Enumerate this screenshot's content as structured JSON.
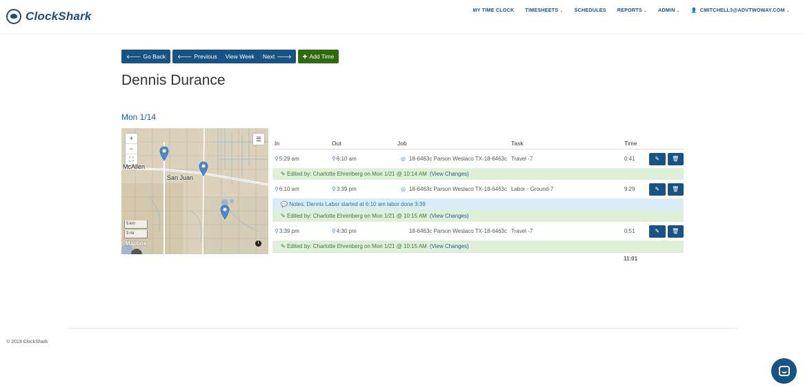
{
  "brand": {
    "name": "ClockShark"
  },
  "nav": {
    "my_time_clock": "MY TIME CLOCK",
    "timesheets": "TIMESHEETS",
    "schedules": "SCHEDULES",
    "reports": "REPORTS",
    "admin": "ADMIN",
    "user": "CMITCHELL3@ADVTWOWAY.COM"
  },
  "toolbar": {
    "go_back": "Go Back",
    "previous": "Previous",
    "view_week": "View Week",
    "next": "Next",
    "add_time": "Add Time"
  },
  "employee": {
    "name": "Dennis Durance"
  },
  "day": {
    "label": "Mon 1/14"
  },
  "map": {
    "zoom_in": "+",
    "zoom_out": "−",
    "labels": {
      "mcallen": "McAllen",
      "san_juan": "San Juan"
    },
    "scale_km": "5 km",
    "scale_mi": "3 mi",
    "attribution": "Mapbox",
    "info": "i"
  },
  "table": {
    "headers": {
      "in": "In",
      "out": "Out",
      "job": "Job",
      "task": "Task",
      "time": "Time"
    },
    "rows": [
      {
        "in": "5:29 am",
        "out": "6:10 am",
        "job": "18-6463c Parson Weslaco TX-18-6463c",
        "task": "Travel -7",
        "time": "0:41",
        "note": "",
        "edited": "Edited by: Charlotte Ehrenberg on Mon 1/21 @ 10:14 AM",
        "view_changes": "(View Changes)"
      },
      {
        "in": "6:10 am",
        "out": "3:39 pm",
        "job": "18-6463c Parson Weslaco TX-18-6463c",
        "task": "Labor - Ground-7",
        "time": "9:29",
        "note": "Notes: Dennis Labor started at 6:10 am labor done 3:39",
        "edited": "Edited by: Charlotte Ehrenberg on Mon 1/21 @ 10:15 AM",
        "view_changes": "(View Changes)"
      },
      {
        "in": "3:39 pm",
        "out": "4:30 pm",
        "job": "18-6463c Parson Weslaco TX-18-6463c",
        "task": "Travel -7",
        "time": "0:51",
        "note": "",
        "edited": "Edited by: Charlotte Ehrenberg on Mon 1/21 @ 10:15 AM",
        "view_changes": "(View Changes)"
      }
    ],
    "total": "11:01"
  },
  "footer": {
    "copyright": "© 2019 ClockShark"
  },
  "colors": {
    "primary": "#175485",
    "success": "#2e6b0f",
    "link": "#1b5c8c"
  }
}
